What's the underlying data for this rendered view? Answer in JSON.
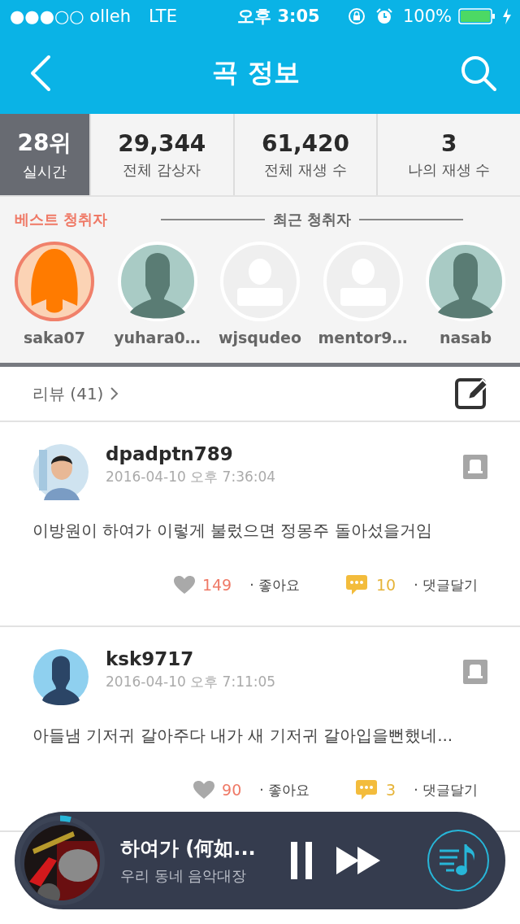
{
  "status_bar": {
    "carrier": "●●●○○ olleh",
    "network": "LTE",
    "time": "오후 3:05",
    "battery": "100%"
  },
  "nav": {
    "title": "곡 정보"
  },
  "stats": [
    {
      "value": "28위",
      "label": "실시간",
      "selected": true
    },
    {
      "value": "29,344",
      "label": "전체 감상자",
      "selected": false
    },
    {
      "value": "61,420",
      "label": "전체 재생 수",
      "selected": false
    },
    {
      "value": "3",
      "label": "나의 재생 수",
      "selected": false
    }
  ],
  "listeners": {
    "best_label": "베스트 청취자",
    "recent_label": "최근 청취자",
    "items": [
      {
        "name": "saka07",
        "kind": "female",
        "best": true
      },
      {
        "name": "yuhara0…",
        "kind": "silhouette",
        "best": false
      },
      {
        "name": "wjsqudeo",
        "kind": "placeholder",
        "best": false
      },
      {
        "name": "mentor9…",
        "kind": "placeholder",
        "best": false
      },
      {
        "name": "nasab",
        "kind": "silhouette",
        "best": false
      }
    ]
  },
  "reviews_header": {
    "title": "리뷰 (41)"
  },
  "reviews": [
    {
      "user": "dpadptn789",
      "date": "2016-04-10 오후 7:36:04",
      "text": "이방원이 하여가 이렇게 불렀으면 정몽주 돌아섰을거임",
      "likes": "149",
      "like_label": "· 좋아요",
      "comments": "10",
      "comment_label": "· 댓글달기"
    },
    {
      "user": "ksk9717",
      "date": "2016-04-10 오후 7:11:05",
      "kind": "silhouette",
      "text": "아들냄 기저귀 갈아주다 내가 새 기저귀 갈아입을뻔했네...",
      "likes": "90",
      "like_label": "· 좋아요",
      "comments": "3",
      "comment_label": "· 댓글달기"
    }
  ],
  "player": {
    "title": "하여가 (何如...",
    "artist": "우리 동네 음악대장",
    "playing": true
  }
}
